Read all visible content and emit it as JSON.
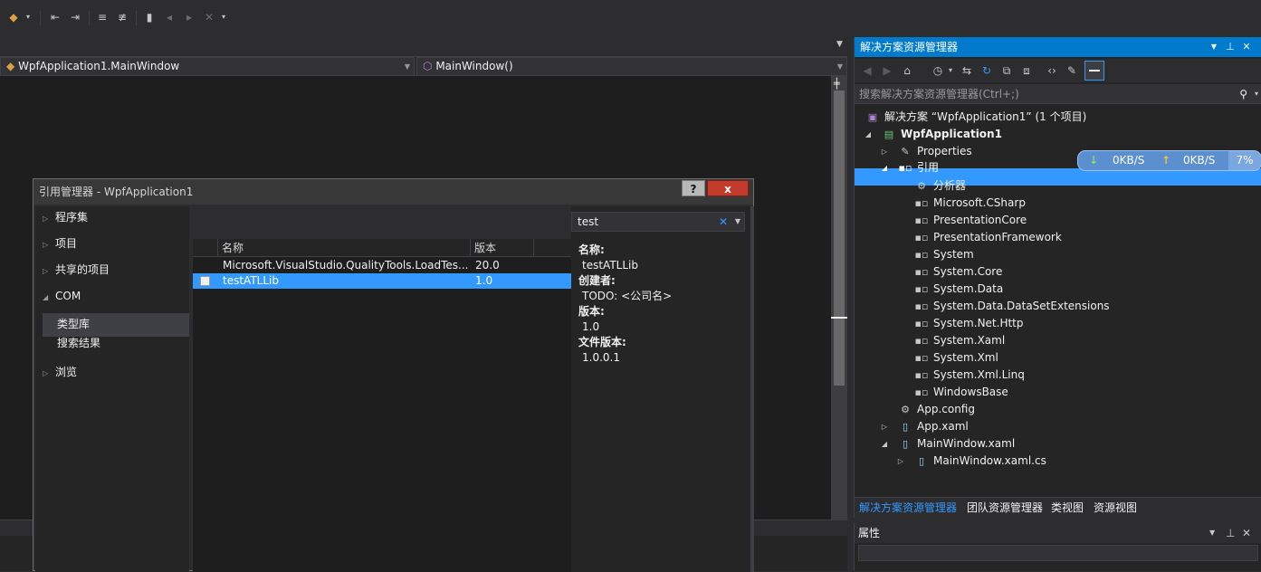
{
  "editor": {
    "class_combo": "WpfApplication1.MainWindow",
    "member_combo": "MainWindow()"
  },
  "dialog": {
    "title": "引用管理器 - WpfApplication1",
    "help_label": "?",
    "close_label": "x",
    "left_nav": {
      "assemblies": "程序集",
      "projects": "项目",
      "shared_projects": "共享的项目",
      "com": "COM",
      "type_libraries": "类型库",
      "search_results": "搜索结果",
      "browse": "浏览"
    },
    "grid": {
      "headers": {
        "name": "名称",
        "version": "版本"
      },
      "rows": [
        {
          "name": "Microsoft.VisualStudio.QualityTools.LoadTes...",
          "version": "20.0",
          "selected": false
        },
        {
          "name": "testATLLib",
          "version": "1.0",
          "selected": true
        }
      ]
    },
    "search": {
      "value": "test"
    },
    "details": {
      "name_label": "名称:",
      "name_value": "testATLLib",
      "creator_label": "创建者:",
      "creator_value": "TODO: <公司名>",
      "version_label": "版本:",
      "version_value": "1.0",
      "file_version_label": "文件版本:",
      "file_version_value": "1.0.0.1"
    }
  },
  "solution_explorer": {
    "title": "解决方案资源管理器",
    "search_placeholder": "搜索解决方案资源管理器(Ctrl+;)",
    "tree": {
      "solution": "解决方案 “WpfApplication1” (1 个项目)",
      "project": "WpfApplication1",
      "properties": "Properties",
      "references": "引用",
      "analyzers": "分析器",
      "refs": [
        "Microsoft.CSharp",
        "PresentationCore",
        "PresentationFramework",
        "System",
        "System.Core",
        "System.Data",
        "System.Data.DataSetExtensions",
        "System.Net.Http",
        "System.Xaml",
        "System.Xml",
        "System.Xml.Linq",
        "WindowsBase"
      ],
      "app_config": "App.config",
      "app_xaml": "App.xaml",
      "main_window_xaml": "MainWindow.xaml",
      "main_window_cs": "MainWindow.xaml.cs"
    },
    "tabs": [
      "解决方案资源管理器",
      "团队资源管理器",
      "类视图",
      "资源视图"
    ],
    "net_badge": {
      "down": "0KB/S",
      "up": "0KB/S",
      "percent": "7%"
    }
  },
  "properties_panel": {
    "title": "属性"
  },
  "colors": {
    "accent": "#007acc",
    "selection": "#3399ff",
    "editor_bg": "#1e1e1e"
  }
}
